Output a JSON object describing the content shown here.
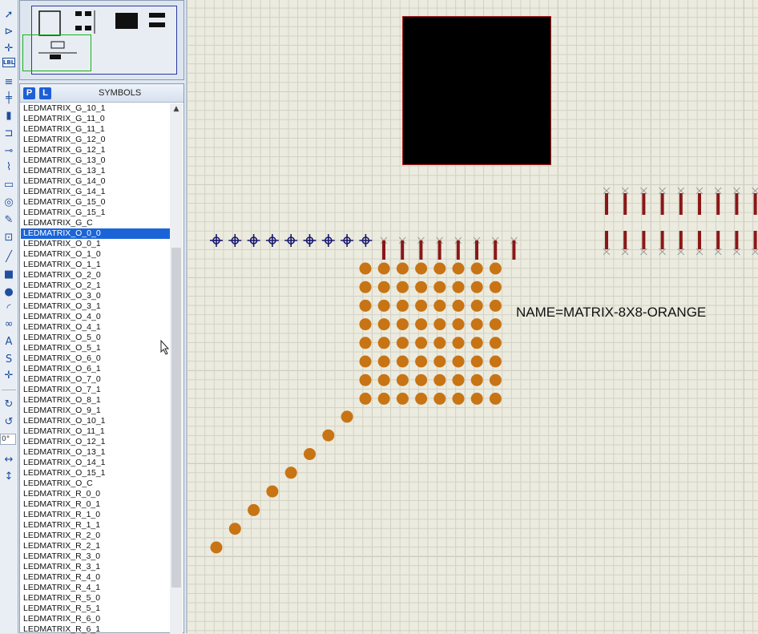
{
  "toolbar": {
    "tools": [
      {
        "name": "selection-tool-icon",
        "glyph": "➚"
      },
      {
        "name": "component-tool-icon",
        "glyph": "⊳"
      },
      {
        "name": "junction-tool-icon",
        "glyph": "✛"
      },
      {
        "name": "wire-label-tool-icon",
        "glyph": "LBL"
      },
      {
        "name": "text-script-tool-icon",
        "glyph": "≡"
      },
      {
        "name": "bus-tool-icon",
        "glyph": "╪"
      },
      {
        "name": "subcircuit-tool-icon",
        "glyph": "▮"
      },
      {
        "name": "terminal-tool-icon",
        "glyph": "⊐"
      },
      {
        "name": "pin-tool-icon",
        "glyph": "⊸"
      },
      {
        "name": "graph-tool-icon",
        "glyph": "⌇"
      },
      {
        "name": "tape-recorder-tool-icon",
        "glyph": "▭"
      },
      {
        "name": "generator-tool-icon",
        "glyph": "◎"
      },
      {
        "name": "probe-tool-icon",
        "glyph": "✎"
      },
      {
        "name": "instrument-tool-icon",
        "glyph": "⊡"
      },
      {
        "name": "line-tool-icon",
        "glyph": "╱"
      },
      {
        "name": "box-tool-icon",
        "glyph": "■"
      },
      {
        "name": "circle-tool-icon",
        "glyph": "●"
      },
      {
        "name": "arc-tool-icon",
        "glyph": "◜"
      },
      {
        "name": "path-tool-icon",
        "glyph": "∞"
      },
      {
        "name": "text-tool-icon",
        "glyph": "A"
      },
      {
        "name": "symbol-tool-icon",
        "glyph": "S"
      },
      {
        "name": "marker-tool-icon",
        "glyph": "✛"
      }
    ],
    "rotate_cw_glyph": "↻",
    "rotate_ccw_glyph": "↺",
    "rotation_value": "0°",
    "mirror_h_glyph": "↔",
    "mirror_v_glyph": "↕"
  },
  "symbols_panel": {
    "p_button": "P",
    "l_button": "L",
    "title": "SYMBOLS",
    "selected_index": 12,
    "items": [
      "LEDMATRIX_G_10_1",
      "LEDMATRIX_G_11_0",
      "LEDMATRIX_G_11_1",
      "LEDMATRIX_G_12_0",
      "LEDMATRIX_G_12_1",
      "LEDMATRIX_G_13_0",
      "LEDMATRIX_G_13_1",
      "LEDMATRIX_G_14_0",
      "LEDMATRIX_G_14_1",
      "LEDMATRIX_G_15_0",
      "LEDMATRIX_G_15_1",
      "LEDMATRIX_G_C",
      "LEDMATRIX_O_0_0",
      "LEDMATRIX_O_0_1",
      "LEDMATRIX_O_1_0",
      "LEDMATRIX_O_1_1",
      "LEDMATRIX_O_2_0",
      "LEDMATRIX_O_2_1",
      "LEDMATRIX_O_3_0",
      "LEDMATRIX_O_3_1",
      "LEDMATRIX_O_4_0",
      "LEDMATRIX_O_4_1",
      "LEDMATRIX_O_5_0",
      "LEDMATRIX_O_5_1",
      "LEDMATRIX_O_6_0",
      "LEDMATRIX_O_6_1",
      "LEDMATRIX_O_7_0",
      "LEDMATRIX_O_7_1",
      "LEDMATRIX_O_8_1",
      "LEDMATRIX_O_9_1",
      "LEDMATRIX_O_10_1",
      "LEDMATRIX_O_11_1",
      "LEDMATRIX_O_12_1",
      "LEDMATRIX_O_13_1",
      "LEDMATRIX_O_14_1",
      "LEDMATRIX_O_15_1",
      "LEDMATRIX_O_C",
      "LEDMATRIX_R_0_0",
      "LEDMATRIX_R_0_1",
      "LEDMATRIX_R_1_0",
      "LEDMATRIX_R_1_1",
      "LEDMATRIX_R_2_0",
      "LEDMATRIX_R_2_1",
      "LEDMATRIX_R_3_0",
      "LEDMATRIX_R_3_1",
      "LEDMATRIX_R_4_0",
      "LEDMATRIX_R_4_1",
      "LEDMATRIX_R_5_0",
      "LEDMATRIX_R_5_1",
      "LEDMATRIX_R_6_0",
      "LEDMATRIX_R_6_1"
    ]
  },
  "canvas": {
    "component_label": "NAME=MATRIX-8X8-ORANGE",
    "led_grid_rows": 8,
    "led_grid_cols": 8,
    "diagonal_dots": 8,
    "top_pins": 8,
    "left_markers": 9,
    "right_pin_rows": 2,
    "right_pins_per_row": 9
  },
  "colors": {
    "led_dot": "#c87414",
    "pin": "#8a1717",
    "pin_cross": "#9c9c9c",
    "marker": "#16166e",
    "selection": "#1a64d8"
  }
}
